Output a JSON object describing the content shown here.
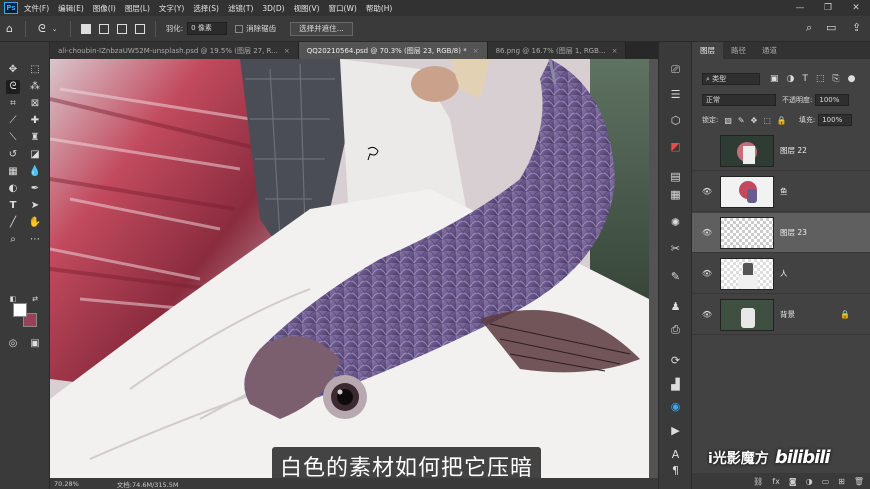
{
  "menu": {
    "logo": "Ps",
    "items": [
      "文件(F)",
      "编辑(E)",
      "图像(I)",
      "图层(L)",
      "文字(Y)",
      "选择(S)",
      "滤镜(T)",
      "3D(D)",
      "视图(V)",
      "窗口(W)",
      "帮助(H)"
    ],
    "minimize": "—",
    "restore": "❐",
    "close": "✕"
  },
  "options": {
    "feather_label": "羽化:",
    "feather_value": "0 像素",
    "antialias_label": "消除锯齿",
    "select_mask_button": "选择并遮住..."
  },
  "tabs": [
    {
      "label": "ali-choubin-IZnbzaUW52M-unsplash.psd @ 19.5% (图层 27, R...",
      "close": "×",
      "active": false
    },
    {
      "label": "QQ20210564.psd @ 70.3% (图层 23, RGB/8) *",
      "close": "×",
      "active": true
    },
    {
      "label": "86.png @ 16.7% (图层 1, RGB...",
      "close": "×",
      "active": false
    }
  ],
  "colors": {
    "foreground": "#ffffff",
    "background": "#9b4059",
    "accent": "#31a8ff"
  },
  "status": {
    "zoom": "70.28%",
    "doc": "文档:74.6M/315.5M"
  },
  "subtitle": "白色的素材如何把它压暗",
  "layers_panel": {
    "tabs": [
      "图层",
      "路径",
      "通道"
    ],
    "filter_label": "类型",
    "blend_mode": "正常",
    "opacity_label": "不透明度:",
    "opacity_value": "100%",
    "lock_label": "锁定:",
    "fill_label": "填充:",
    "fill_value": "100%",
    "layers": [
      {
        "name": "图层 22",
        "visible": false,
        "selected": false,
        "locked": false,
        "thumb": "scene"
      },
      {
        "name": "鱼",
        "visible": true,
        "selected": false,
        "locked": false,
        "thumb": "fish"
      },
      {
        "name": "图层 23",
        "visible": true,
        "selected": true,
        "locked": false,
        "thumb": "empty"
      },
      {
        "name": "人",
        "visible": true,
        "selected": false,
        "locked": false,
        "thumb": "person"
      },
      {
        "name": "背景",
        "visible": true,
        "selected": false,
        "locked": true,
        "thumb": "forest"
      }
    ]
  },
  "watermark": {
    "text": "i光影魔方",
    "brand": "bilibili"
  }
}
